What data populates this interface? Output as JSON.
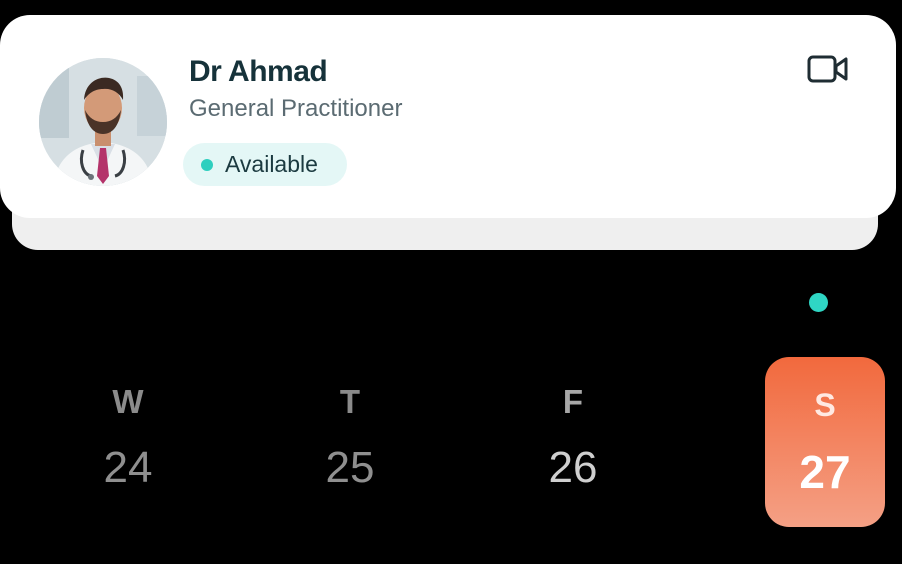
{
  "doctor": {
    "name": "Dr Ahmad",
    "specialty": "General Practitioner",
    "status": "Available",
    "status_color": "#2ecfbf",
    "avatar_icon": "doctor-portrait",
    "call_icon": "video-camera-icon"
  },
  "calendar": {
    "days": [
      {
        "letter": "W",
        "number": "24",
        "selected": false
      },
      {
        "letter": "T",
        "number": "25",
        "selected": false
      },
      {
        "letter": "F",
        "number": "26",
        "selected": false
      },
      {
        "letter": "S",
        "number": "27",
        "selected": true
      }
    ],
    "selected_color_top": "#f2693d",
    "selected_color_bottom": "#f4a085",
    "indicator_color": "#2fd6c4"
  }
}
